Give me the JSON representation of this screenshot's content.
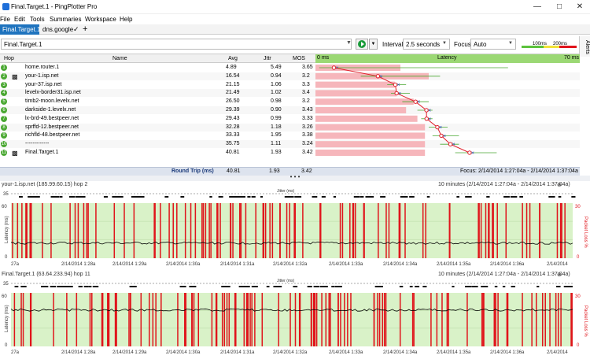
{
  "window": {
    "tab_title": "Final.Target.1",
    "app_name": "PingPlotter Pro"
  },
  "menu": [
    "File",
    "Edit",
    "Tools",
    "Summaries",
    "Workspace",
    "Help"
  ],
  "tabs": {
    "active": "Final.Target.1",
    "second": "dns.google"
  },
  "toolbar": {
    "target": "Final.Target.1",
    "interval_label": "Interval",
    "interval_value": "2.5 seconds",
    "focus_label": "Focus",
    "focus_value": "Auto",
    "scale_low": "100ms",
    "scale_high": "200ms"
  },
  "alerts_label": "Alerts",
  "columns": {
    "hop": "Hop",
    "name": "Name",
    "avg": "Avg",
    "jitter": "Jttr",
    "mos": "MOS",
    "latency_min": "0 ms",
    "latency": "Latency",
    "latency_max": "70 ms"
  },
  "hops": [
    {
      "num": "1",
      "name": "home.router.1",
      "avg": "4.89",
      "jitter": "5.49",
      "mos": "3.65",
      "lat": 4.89,
      "bar": 22.5,
      "min": 1,
      "max": 51
    },
    {
      "num": "2",
      "name": "your-1.isp.net",
      "avg": "16.54",
      "jitter": "0.94",
      "mos": "3.2",
      "lat": 16.54,
      "bar": 30,
      "min": 12,
      "max": 33
    },
    {
      "num": "3",
      "name": "your-37.isp.net",
      "avg": "21.15",
      "jitter": "1.06",
      "mos": "3.3",
      "lat": 21.15,
      "bar": 21,
      "min": 19,
      "max": 24
    },
    {
      "num": "4",
      "name": "levelx-border31.isp.net",
      "avg": "21.49",
      "jitter": "1.02",
      "mos": "3.4",
      "lat": 21.49,
      "bar": 21.5,
      "min": 20,
      "max": 25
    },
    {
      "num": "5",
      "name": "timb2-moon.levelx.net",
      "avg": "26.50",
      "jitter": "0.98",
      "mos": "3.2",
      "lat": 26.5,
      "bar": 26,
      "min": 23,
      "max": 30
    },
    {
      "num": "6",
      "name": "darkside-1.levelx.net",
      "avg": "29.39",
      "jitter": "0.90",
      "mos": "3.43",
      "lat": 29.39,
      "bar": 24,
      "min": 27,
      "max": 31
    },
    {
      "num": "7",
      "name": "lx-brd-49.bestpeer.net",
      "avg": "29.43",
      "jitter": "0.99",
      "mos": "3.33",
      "lat": 29.43,
      "bar": 27,
      "min": 28,
      "max": 31
    },
    {
      "num": "8",
      "name": "sprffd-12.bestpeer.net",
      "avg": "32.28",
      "jitter": "1.18",
      "mos": "3.26",
      "lat": 32.28,
      "bar": 29,
      "min": 30,
      "max": 35
    },
    {
      "num": "9",
      "name": "richfld-48.bestpeer.net",
      "avg": "33.33",
      "jitter": "1.95",
      "mos": "3.38",
      "lat": 33.33,
      "bar": 29,
      "min": 31,
      "max": 38
    },
    {
      "num": "10",
      "name": "-------------",
      "avg": "35.75",
      "jitter": "1.11",
      "mos": "3.24",
      "lat": 35.75,
      "bar": 29,
      "min": 33,
      "max": 38
    },
    {
      "num": "11",
      "name": "Final.Target.1",
      "avg": "40.81",
      "jitter": "1.93",
      "mos": "3.42",
      "lat": 40.81,
      "bar": 29,
      "min": 37,
      "max": 48
    }
  ],
  "summary": {
    "label": "Round Trip (ms)",
    "avg": "40.81",
    "jitter": "1.93",
    "mos": "3.42",
    "focus": "Focus: 2/14/2014 1:27:04a - 2/14/2014 1:37:04a"
  },
  "graphs": [
    {
      "title": "your-1.isp.net (185.99.60.15) hop 2",
      "range": "10 minutes (2/14/2014 1:27:04a - 2/14/2014 1:37:04a)",
      "y_label": "Latency (ms)",
      "y_right_label": "Packet Loss %",
      "y_ticks": [
        "60",
        "0"
      ],
      "y_right_ticks": [
        "30",
        "0"
      ],
      "jitter_label": "Jitter (ms)",
      "jitter_tick": "35",
      "x_ticks": [
        "27a",
        "2/14/2014 1:28a",
        "2/14/2014 1:29a",
        "2/14/2014 1:30a",
        "2/14/2014 1:31a",
        "2/14/2014 1:32a",
        "2/14/2014 1:33a",
        "2/14/2014 1:34a",
        "2/14/2014 1:35a",
        "2/14/2014 1:36a",
        "2/14/2014"
      ],
      "latency_level": 16.5
    },
    {
      "title": "Final.Target.1 (63.64.233.94) hop 11",
      "range": "10 minutes (2/14/2014 1:27:04a - 2/14/2014 1:37:04a)",
      "y_label": "Latency (ms)",
      "y_right_label": "Packet Loss %",
      "y_ticks": [
        "60",
        "0"
      ],
      "y_right_ticks": [
        "30",
        "0"
      ],
      "jitter_label": "Jitter (ms)",
      "jitter_tick": "35",
      "x_ticks": [
        "27a",
        "2/14/2014 1:28a",
        "2/14/2014 1:29a",
        "2/14/2014 1:30a",
        "2/14/2014 1:31a",
        "2/14/2014 1:32a",
        "2/14/2014 1:33a",
        "2/14/2014 1:34a",
        "2/14/2014 1:35a",
        "2/14/2014 1:36a",
        "2/14/2014"
      ],
      "latency_level": 40.8
    }
  ],
  "colors": {
    "accent": "#1e73be",
    "green": "#4aa832",
    "graph_bg": "#d9f2c8",
    "loss": "#e0141b",
    "bar": "#f6b6bb",
    "line": "#e01e2a"
  }
}
